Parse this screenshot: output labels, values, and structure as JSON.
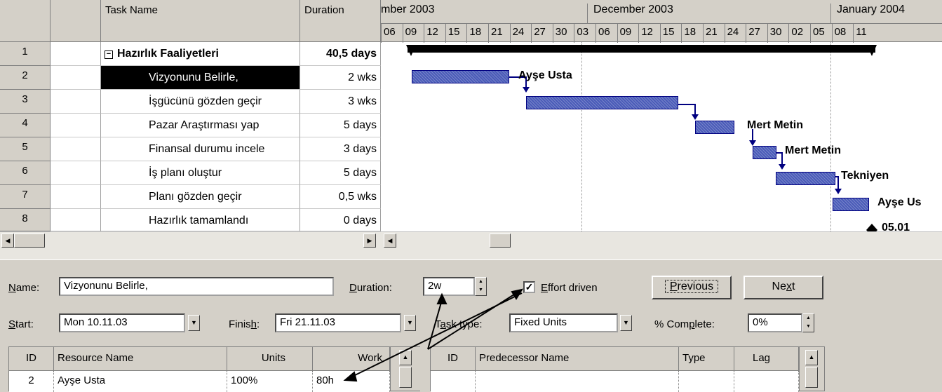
{
  "grid": {
    "headers": {
      "info": "i",
      "task_name": "Task Name",
      "duration": "Duration"
    },
    "rows": [
      {
        "id": "1",
        "name": "Hazırlık Faaliyetleri",
        "duration": "40,5 days",
        "summary": true
      },
      {
        "id": "2",
        "name": "Vizyonunu Belirle,",
        "duration": "2 wks",
        "selected": true
      },
      {
        "id": "3",
        "name": "İşgücünü gözden geçir",
        "duration": "3 wks"
      },
      {
        "id": "4",
        "name": "Pazar Araştırması yap",
        "duration": "5 days"
      },
      {
        "id": "5",
        "name": "Finansal durumu incele",
        "duration": "3 days"
      },
      {
        "id": "6",
        "name": "İş planı oluştur",
        "duration": "5 days"
      },
      {
        "id": "7",
        "name": "Planı gözden geçir",
        "duration": "0,5 wks"
      },
      {
        "id": "8",
        "name": "Hazırlık tamamlandı",
        "duration": "0 days"
      }
    ]
  },
  "gantt": {
    "months": [
      "mber 2003",
      "December 2003",
      "January 2004"
    ],
    "days": [
      "06",
      "09",
      "12",
      "15",
      "18",
      "21",
      "24",
      "27",
      "30",
      "03",
      "06",
      "09",
      "12",
      "15",
      "18",
      "21",
      "24",
      "27",
      "30",
      "02",
      "05",
      "08",
      "11"
    ],
    "resource_labels": [
      "Ayşe Usta",
      "Mert Metin",
      "Mert Metin",
      "Tekniyen",
      "Ayşe Us"
    ],
    "milestone_label": "05.01",
    "bar_color": "#4a5bb8"
  },
  "form": {
    "name_label": "Name:",
    "name_value": "Vizyonunu Belirle,",
    "duration_label": "Duration:",
    "duration_value": "2w",
    "effort_driven_label": "Effort driven",
    "effort_driven_checked": true,
    "previous_label": "Previous",
    "next_label": "Next",
    "start_label": "Start:",
    "start_value": "Mon 10.11.03",
    "finish_label": "Finish:",
    "finish_value": "Fri 21.11.03",
    "task_type_label": "Task type:",
    "task_type_value": "Fixed Units",
    "complete_label": "% Complete:",
    "complete_value": "0%"
  },
  "resources": {
    "headers": [
      "ID",
      "Resource Name",
      "Units",
      "Work"
    ],
    "rows": [
      {
        "id": "2",
        "name": "Ayşe Usta",
        "units": "100%",
        "work": "80h"
      }
    ]
  },
  "predecessors": {
    "headers": [
      "ID",
      "Predecessor Name",
      "Type",
      "Lag"
    ]
  }
}
